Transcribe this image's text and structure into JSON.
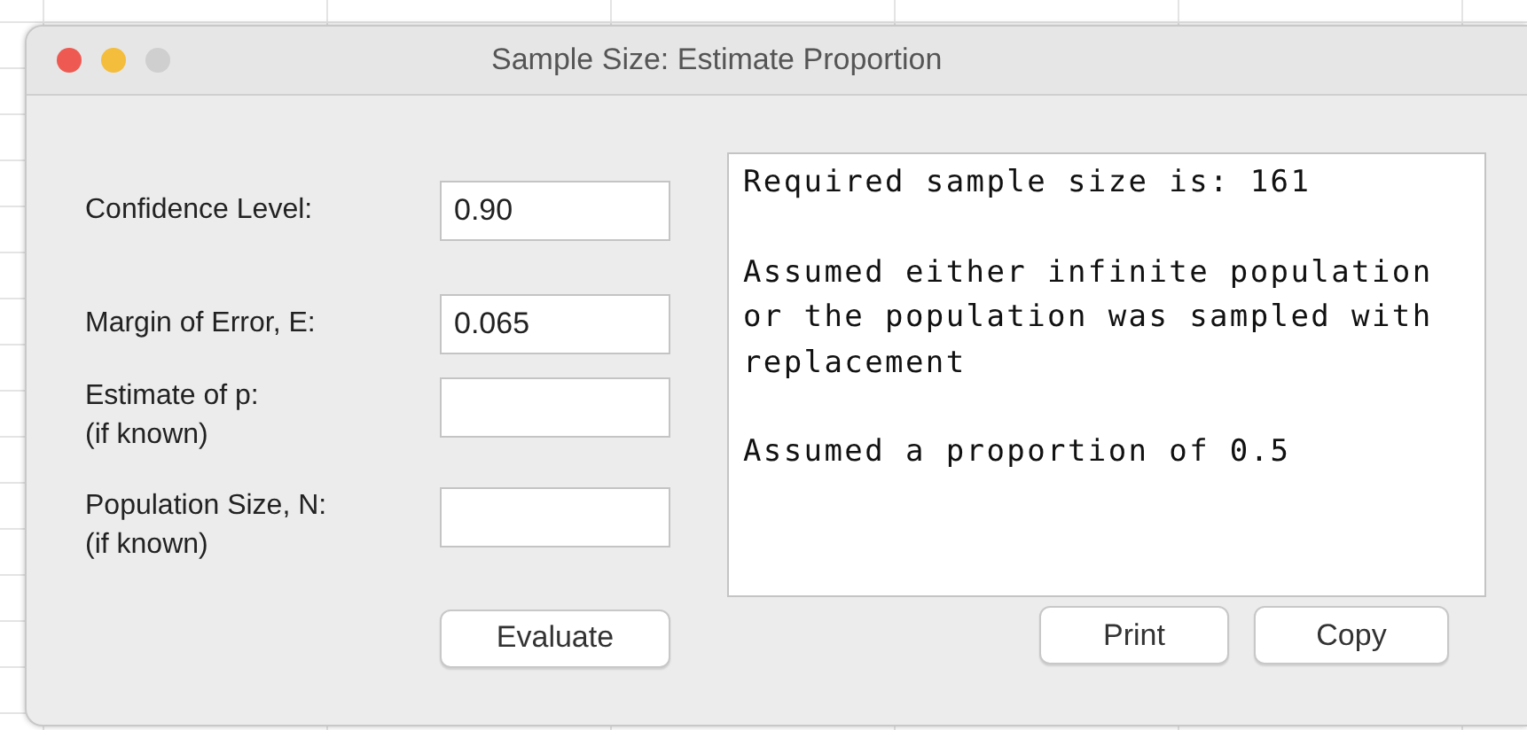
{
  "window": {
    "title": "Sample Size: Estimate Proportion"
  },
  "fields": [
    {
      "label": [
        "Confidence Level:"
      ],
      "value": "0.90"
    },
    {
      "label": [
        "Margin of Error, E:"
      ],
      "value": "0.065"
    },
    {
      "label": [
        "Estimate of p:",
        "(if known)"
      ]
    },
    {
      "label": [
        "Population Size, N:",
        "(if known)"
      ]
    }
  ],
  "evaluate_button": "Evaluate",
  "output": [
    [
      "Required sample size is: 161"
    ],
    [
      "Assumed either infinite population",
      "or the population was sampled with",
      "replacement"
    ],
    [
      "Assumed a proportion of 0.5"
    ]
  ],
  "buttons": [
    "Print",
    "Copy"
  ]
}
